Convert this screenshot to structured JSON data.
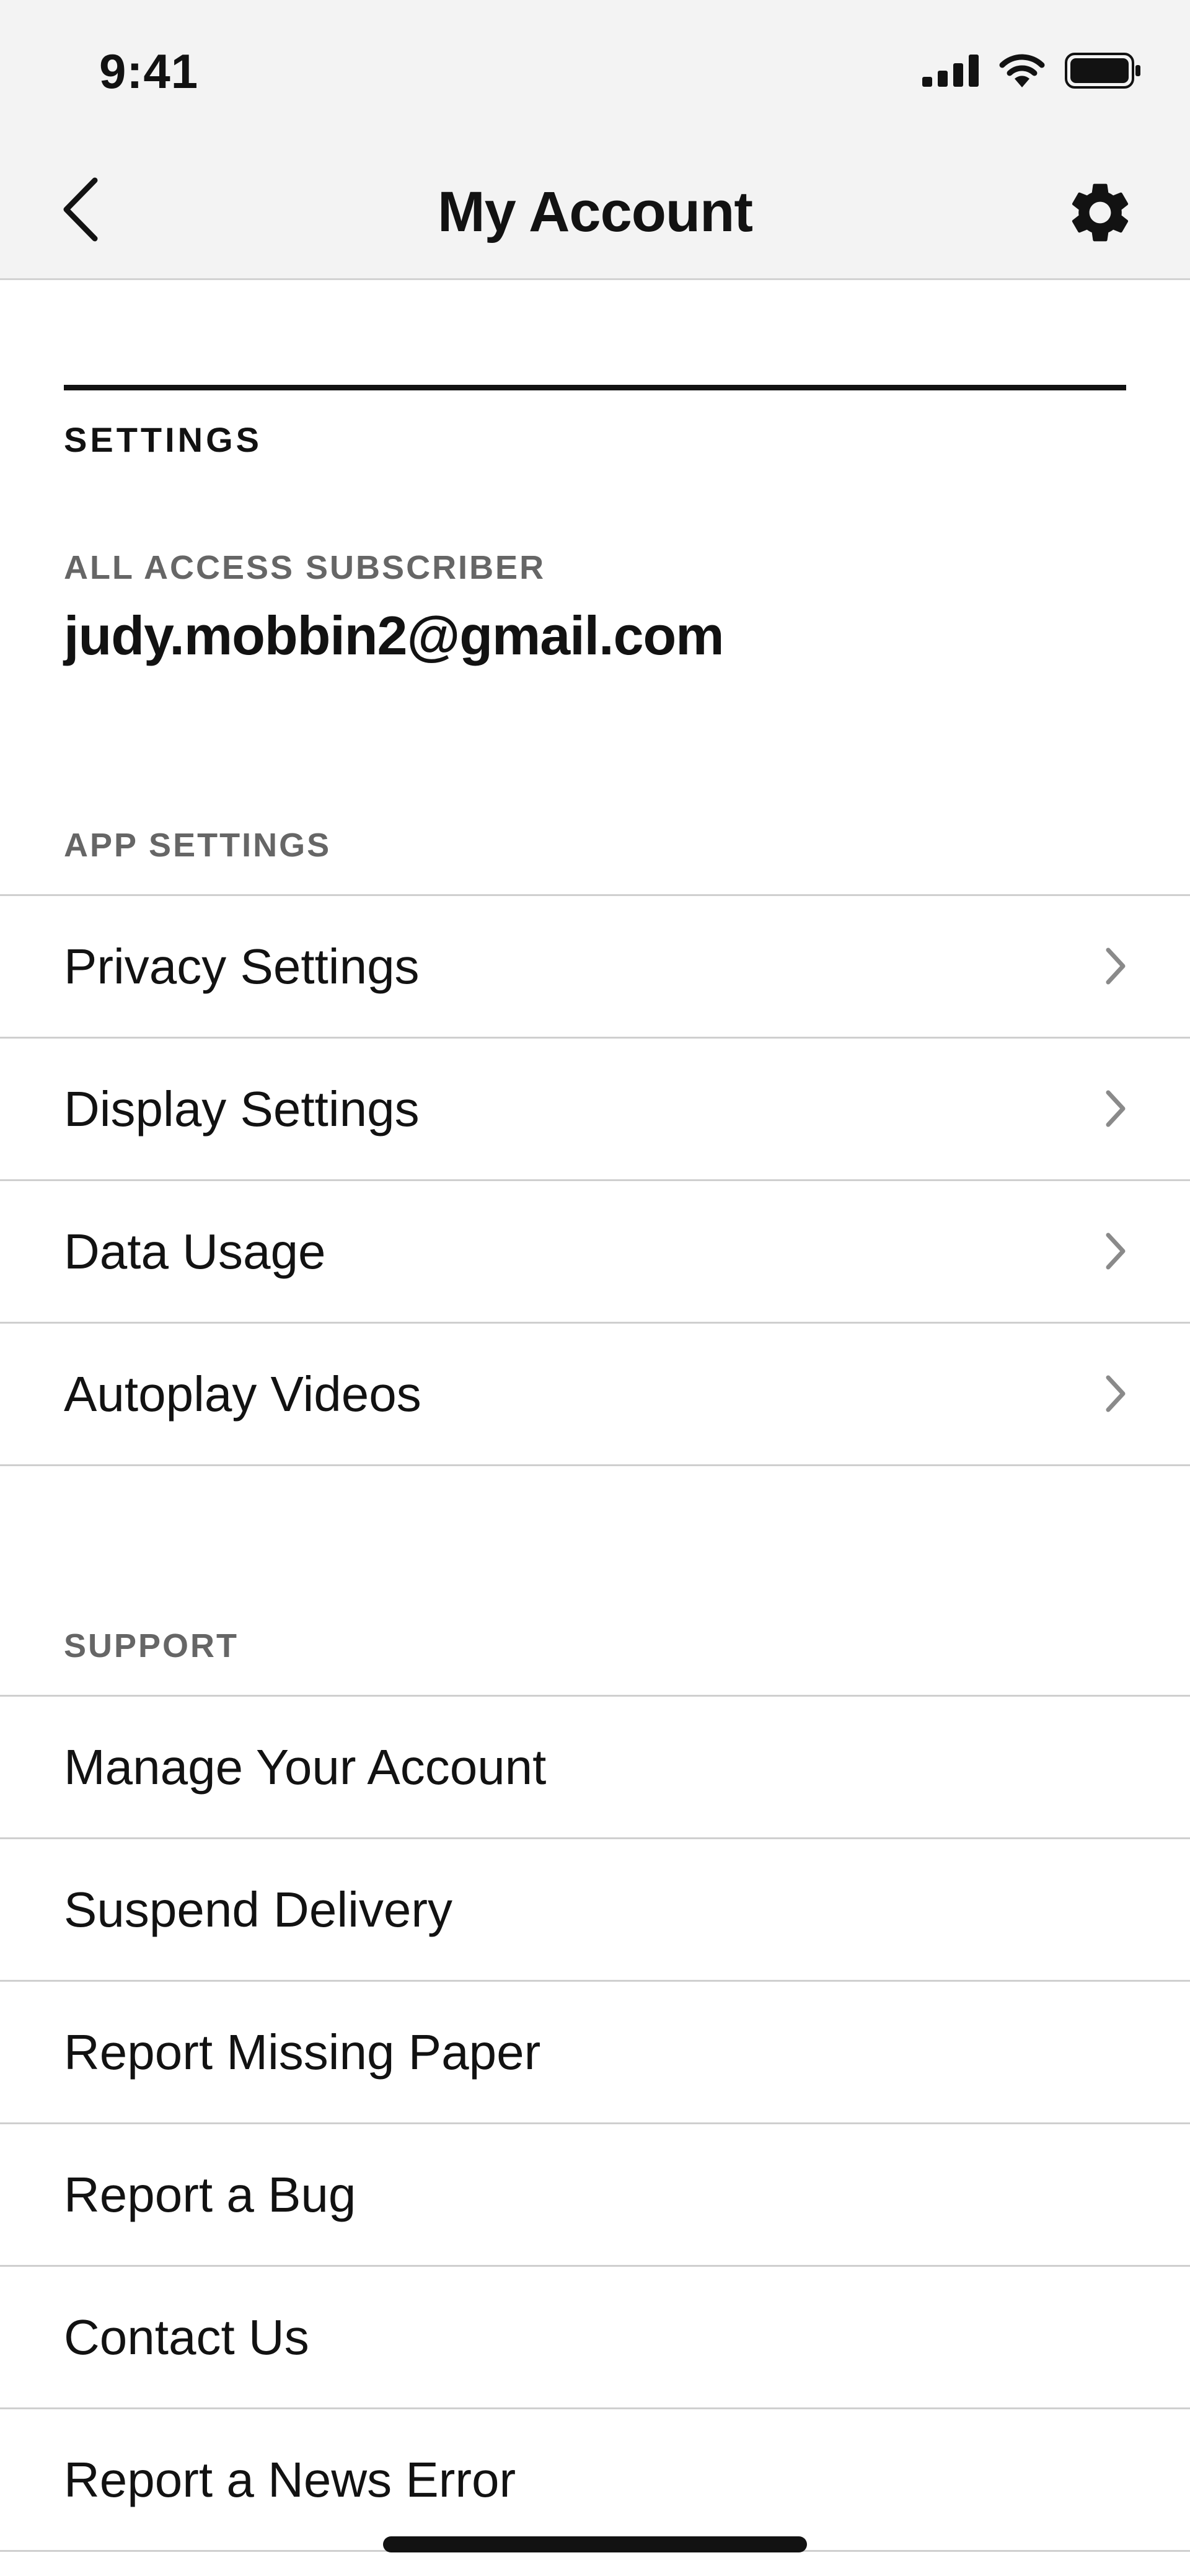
{
  "status_bar": {
    "time": "9:41"
  },
  "nav": {
    "title": "My Account",
    "back_icon": "chevron-left-icon",
    "settings_icon": "gear-icon"
  },
  "account": {
    "heading": "SETTINGS",
    "subscriber_label": "ALL ACCESS SUBSCRIBER",
    "email": "judy.mobbin2@gmail.com"
  },
  "app_settings": {
    "label": "APP SETTINGS",
    "items": [
      {
        "label": "Privacy Settings"
      },
      {
        "label": "Display Settings"
      },
      {
        "label": "Data Usage"
      },
      {
        "label": "Autoplay Videos"
      }
    ]
  },
  "support": {
    "label": "SUPPORT",
    "items": [
      {
        "label": "Manage Your Account"
      },
      {
        "label": "Suspend Delivery"
      },
      {
        "label": "Report Missing Paper"
      },
      {
        "label": "Report a Bug"
      },
      {
        "label": "Contact Us"
      },
      {
        "label": "Report a News Error"
      }
    ]
  },
  "colors": {
    "text": "#121212",
    "muted": "#666666",
    "divider": "#cfcfcf",
    "header_bg": "#f3f3f3"
  }
}
